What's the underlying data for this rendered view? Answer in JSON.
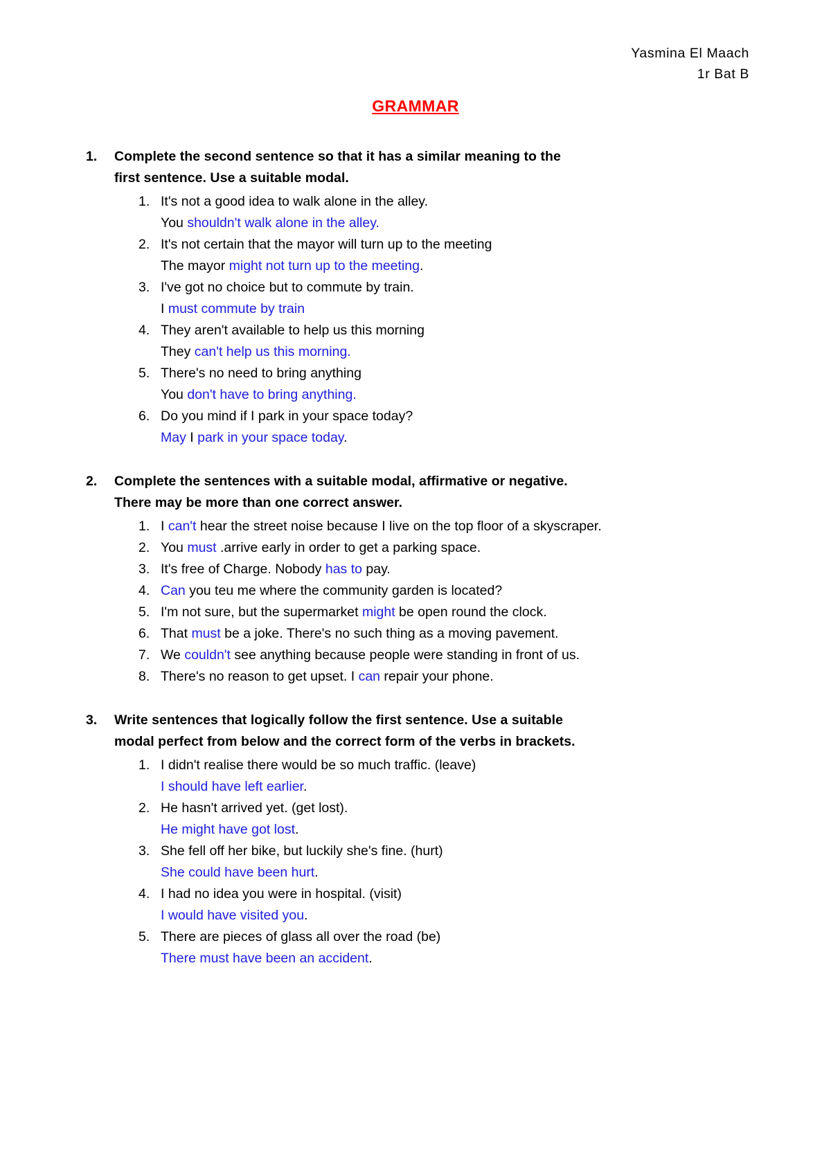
{
  "header": {
    "student_name": "Yasmina El Maach",
    "class_group": "1r Bat B"
  },
  "title": {
    "text": "GRAMMAR",
    "color": "#ff0000"
  },
  "answer_color": "#2020dd",
  "sections": [
    {
      "number": "1.",
      "heading_line1": "Complete the second sentence so that it has a similar meaning to the",
      "heading_line2": "first sentence. Use a suitable modal.",
      "items": [
        {
          "number": "1.",
          "prompt": "It's not a good idea to walk alone in the alley.",
          "answer_lead": "You ",
          "answer_blue": "shouldn't walk alone in the alley.",
          "answer_tail": ""
        },
        {
          "number": "2.",
          "prompt": "It's not certain that the mayor will turn up to the meeting",
          "answer_lead": "The mayor ",
          "answer_blue": "might not turn up to the meeting",
          "answer_tail": "."
        },
        {
          "number": "3.",
          "prompt": "I've got no choice but to commute by train.",
          "answer_lead": "I ",
          "answer_blue": "must commute by train",
          "answer_tail": ""
        },
        {
          "number": "4.",
          "prompt": "They aren't available to help us this morning",
          "answer_lead": "They ",
          "answer_blue": "can't help us this morning.",
          "answer_tail": ""
        },
        {
          "number": "5.",
          "prompt": "There's no need to bring anything",
          "answer_lead": "You ",
          "answer_blue": "don't have to bring anything.",
          "answer_tail": ""
        },
        {
          "number": "6.",
          "prompt": "Do you mind if I park in your space today?",
          "answer_lead": "",
          "answer_blue_1": "May",
          "answer_mid": " I ",
          "answer_blue_2": "park in your space today",
          "answer_tail": "."
        }
      ]
    },
    {
      "number": "2.",
      "heading_line1": "Complete the sentences with a suitable modal, affirmative or negative.",
      "heading_line2": "There may be more than one correct answer.",
      "items": [
        {
          "number": "1.",
          "pre": "I ",
          "blue": "can't",
          "post": " hear the street noise because I live on the top floor of a skyscraper.",
          "justified": true
        },
        {
          "number": "2.",
          "pre": "You ",
          "blue": "must",
          "post": " .arrive early in order to get a parking space.",
          "justified": false
        },
        {
          "number": "3.",
          "pre": "It's free of Charge. Nobody ",
          "blue": "has to",
          "post": " pay.",
          "justified": false
        },
        {
          "number": "4.",
          "pre": "",
          "blue": "Can",
          "post": " you teu me where the community garden is located?",
          "justified": false
        },
        {
          "number": "5.",
          "pre": "I'm not sure, but the supermarket ",
          "blue": "might",
          "post": " be open round the clock.",
          "justified": false
        },
        {
          "number": "6.",
          "pre": "That ",
          "blue": "must",
          "post": " be a joke. There's no such thing as a moving pavement.",
          "justified": false
        },
        {
          "number": "7.",
          "pre": "We ",
          "blue": "couldn't",
          "post": " see anything because people were standing in front of us.",
          "justified": false
        },
        {
          "number": "8.",
          "pre": "There's no reason to get upset. I ",
          "blue": "can",
          "post": " repair your phone.",
          "justified": false
        }
      ]
    },
    {
      "number": "3.",
      "heading_line1": "Write sentences that logically follow the first sentence. Use a suitable",
      "heading_line2": "modal perfect from below and the correct form of the verbs in brackets.",
      "items": [
        {
          "number": "1.",
          "prompt": "I didn't realise there would be so much traffic. (leave)",
          "answer_blue": "I should have left earlier",
          "answer_tail": "."
        },
        {
          "number": "2.",
          "prompt": "He hasn't arrived yet. (get lost).",
          "answer_blue": "He might have got lost",
          "answer_tail": "."
        },
        {
          "number": "3.",
          "prompt": "She fell off her bike, but luckily she's fine. (hurt)",
          "answer_blue": "She could have been hurt",
          "answer_tail": "."
        },
        {
          "number": "4.",
          "prompt": "I had no idea you were in hospital. (visit)",
          "answer_blue": "I would have visited you",
          "answer_tail": "."
        },
        {
          "number": "5.",
          "prompt": "There are pieces of glass all over the road (be)",
          "answer_blue": "There must have been an accident",
          "answer_tail": "."
        }
      ]
    }
  ]
}
